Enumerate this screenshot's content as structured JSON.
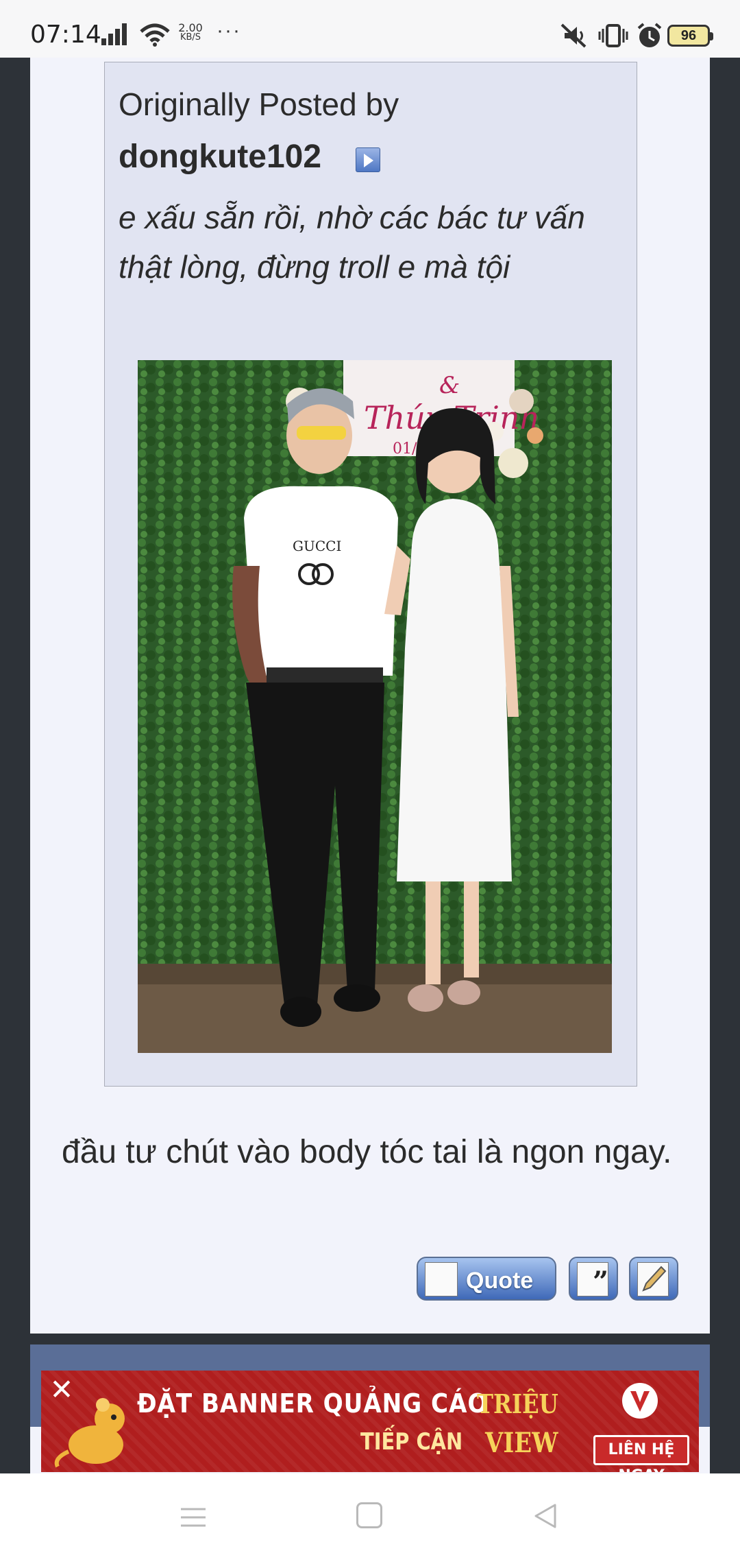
{
  "status_bar": {
    "time": "07:14",
    "network_speed_value": "2.00",
    "network_speed_unit": "KB/S",
    "more": "···",
    "battery": "96"
  },
  "quote": {
    "header": "Originally Posted by",
    "author": "dongkute102",
    "text": "e xấu sẵn rồi, nhờ các bác tư vấn thật lòng, đừng troll e mà tội"
  },
  "photo": {
    "sign_line1": "Thúy Trinh",
    "sign_amp": "&",
    "sign_date": "01/3/",
    "shirt_brand": "GUCCI"
  },
  "reply": {
    "text": "đầu tư chút vào body tóc tai là ngon ngay."
  },
  "actions": {
    "quote_label": "Quote"
  },
  "ad": {
    "close": "✕",
    "line1": "ĐẶT BANNER QUẢNG CÁO",
    "line2": "TIẾP CẬN",
    "highlight1": "TRIỆU",
    "highlight2": "VIEW",
    "cta": "LIÊN HỆ NGAY"
  }
}
